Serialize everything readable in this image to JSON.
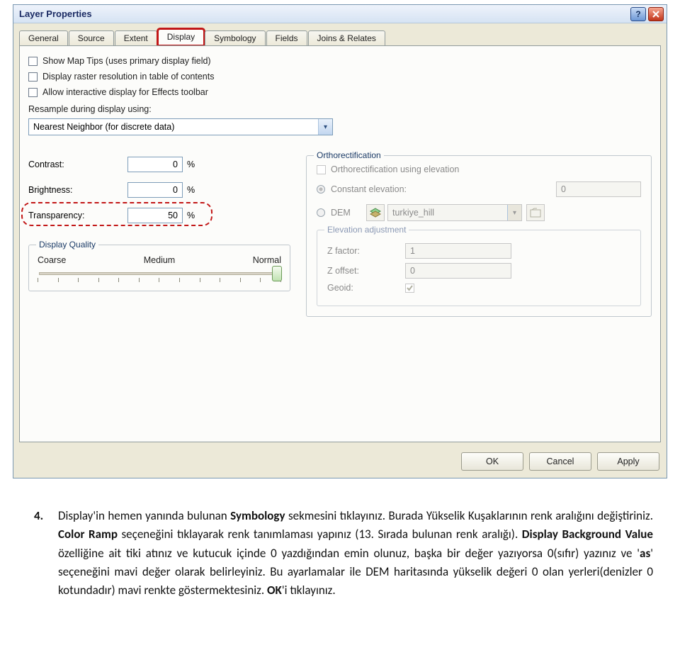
{
  "window": {
    "title": "Layer Properties"
  },
  "tabs": [
    "General",
    "Source",
    "Extent",
    "Display",
    "Symbology",
    "Fields",
    "Joins & Relates"
  ],
  "checks": {
    "showMapTips": "Show Map Tips (uses primary display field)",
    "displayRasterRes": "Display raster resolution in table of contents",
    "allowInteractive": "Allow interactive display for Effects toolbar"
  },
  "resample": {
    "label": "Resample during display using:",
    "value": "Nearest Neighbor (for discrete data)"
  },
  "adjust": {
    "contrastLabel": "Contrast:",
    "contrastValue": "0",
    "brightnessLabel": "Brightness:",
    "brightnessValue": "0",
    "transparencyLabel": "Transparency:",
    "transparencyValue": "50",
    "pct": "%"
  },
  "dq": {
    "title": "Display Quality",
    "coarse": "Coarse",
    "medium": "Medium",
    "normal": "Normal"
  },
  "ortho": {
    "title": "Orthorectification",
    "usingElev": "Orthorectification using elevation",
    "constElev": "Constant elevation:",
    "constElevVal": "0",
    "dem": "DEM",
    "demValue": "turkiye_hill",
    "elevAdj": "Elevation adjustment",
    "zfactorLabel": "Z factor:",
    "zfactorVal": "1",
    "zoffsetLabel": "Z offset:",
    "zoffsetVal": "0",
    "geoid": "Geoid:"
  },
  "buttons": {
    "ok": "OK",
    "cancel": "Cancel",
    "apply": "Apply"
  },
  "doc": {
    "marker": "4.",
    "p": "Display'in hemen yanında bulunan <b>Symbology</b> sekmesini tıklayınız. Burada Yükselik Kuşaklarının renk aralığını değiştiriniz. <b>Color Ramp</b> seçeneğini tıklayarak renk tanımlaması yapınız (13. Sırada bulunan renk aralığı). <b>Display Background Value</b> özelliğine ait tiki atınız ve kutucuk içinde 0 yazdığından emin olunuz, başka bir değer yazıyorsa 0(sıfır) yazınız ve '<b>as</b>' seçeneğini mavi değer olarak belirleyiniz. Bu ayarlamalar ile DEM haritasında yükselik değeri 0 olan yerleri(denizler 0 kotundadır) mavi renkte göstermektesiniz. <b>OK</b>'i tıklayınız."
  }
}
